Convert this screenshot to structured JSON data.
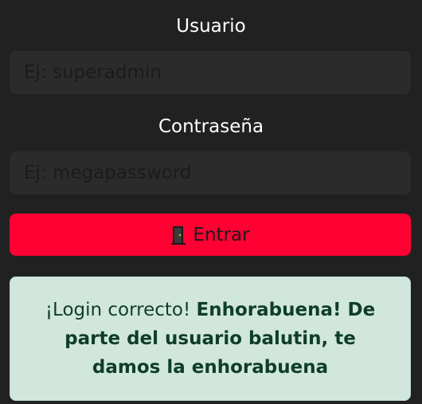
{
  "form": {
    "username_label": "Usuario",
    "username_placeholder": "Ej: superadmin",
    "username_value": "",
    "password_label": "Contraseña",
    "password_placeholder": "Ej: megapassword",
    "password_value": "",
    "submit_label": "Entrar",
    "submit_icon": "door-icon"
  },
  "alert": {
    "prefix": "¡Login correcto! ",
    "message_bold": "Enhorabuena! De parte del usuario balutin, te damos la enhorabuena"
  },
  "colors": {
    "background": "#212121",
    "input_background": "#2b2b2b",
    "button": "#ff0033",
    "alert_background": "#d1e7dd",
    "alert_text": "#0f3d2a"
  }
}
